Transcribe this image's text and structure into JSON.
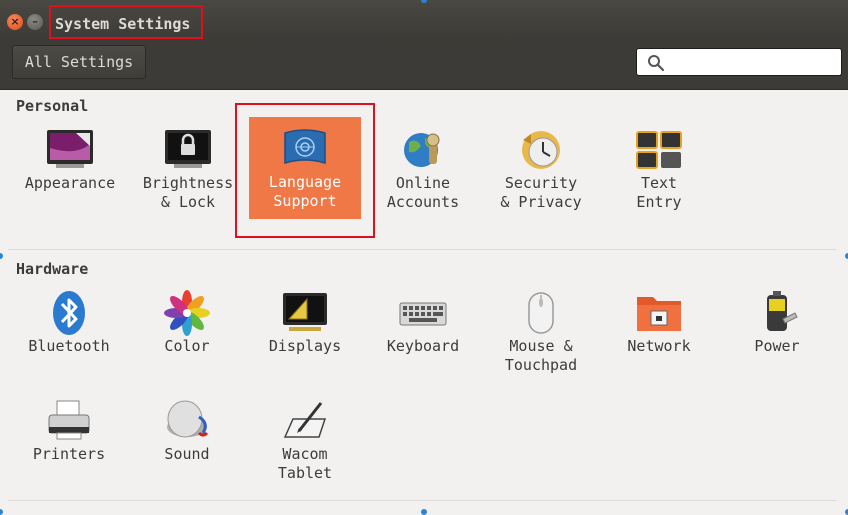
{
  "window": {
    "title": "System Settings",
    "close_glyph": "×",
    "minimize_glyph": "–"
  },
  "toolbar": {
    "all_settings_label": "All Settings",
    "search_placeholder": "",
    "search_value": ""
  },
  "sections": {
    "personal": {
      "title": "Personal",
      "items": [
        {
          "label": "Appearance",
          "icon": "appearance-icon"
        },
        {
          "label": "Brightness\n& Lock",
          "icon": "lock-icon"
        },
        {
          "label": "Language\nSupport",
          "icon": "language-flag-icon",
          "selected": true
        },
        {
          "label": "Online\nAccounts",
          "icon": "online-accounts-icon"
        },
        {
          "label": "Security\n& Privacy",
          "icon": "clock-icon"
        },
        {
          "label": "Text\nEntry",
          "icon": "keyboard-keys-icon"
        }
      ]
    },
    "hardware": {
      "title": "Hardware",
      "items": [
        {
          "label": "Bluetooth",
          "icon": "bluetooth-icon"
        },
        {
          "label": "Color",
          "icon": "color-flower-icon"
        },
        {
          "label": "Displays",
          "icon": "display-icon"
        },
        {
          "label": "Keyboard",
          "icon": "keyboard-icon"
        },
        {
          "label": "Mouse &\nTouchpad",
          "icon": "mouse-icon"
        },
        {
          "label": "Network",
          "icon": "network-folder-icon"
        },
        {
          "label": "Power",
          "icon": "battery-icon"
        },
        {
          "label": "Printers",
          "icon": "printer-icon"
        },
        {
          "label": "Sound",
          "icon": "speaker-icon"
        },
        {
          "label": "Wacom\nTablet",
          "icon": "tablet-pen-icon"
        }
      ]
    }
  },
  "colors": {
    "accent": "#f07746",
    "titlebar": "#3c3b37",
    "annotation": "#e0101a"
  }
}
